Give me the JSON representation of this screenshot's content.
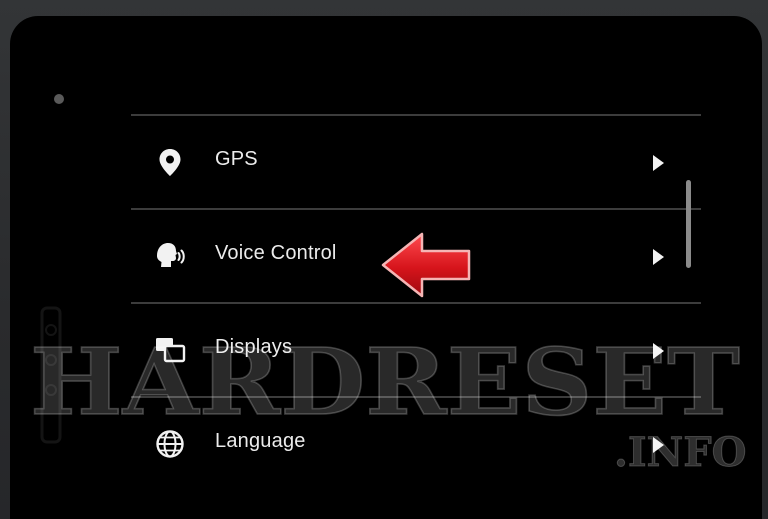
{
  "menu": {
    "items": [
      {
        "label": "GPS",
        "icon": "location-pin-icon"
      },
      {
        "label": "Voice Control",
        "icon": "voice-control-icon"
      },
      {
        "label": "Displays",
        "icon": "displays-icon"
      },
      {
        "label": "Language",
        "icon": "globe-icon"
      }
    ]
  },
  "watermark": {
    "main": "HARDRESET",
    "sub": ".INFO"
  },
  "colors": {
    "screen_bg": "#000000",
    "text": "#ececec",
    "divider": "#3c3c3c",
    "arrow_red": "#d6141b"
  }
}
